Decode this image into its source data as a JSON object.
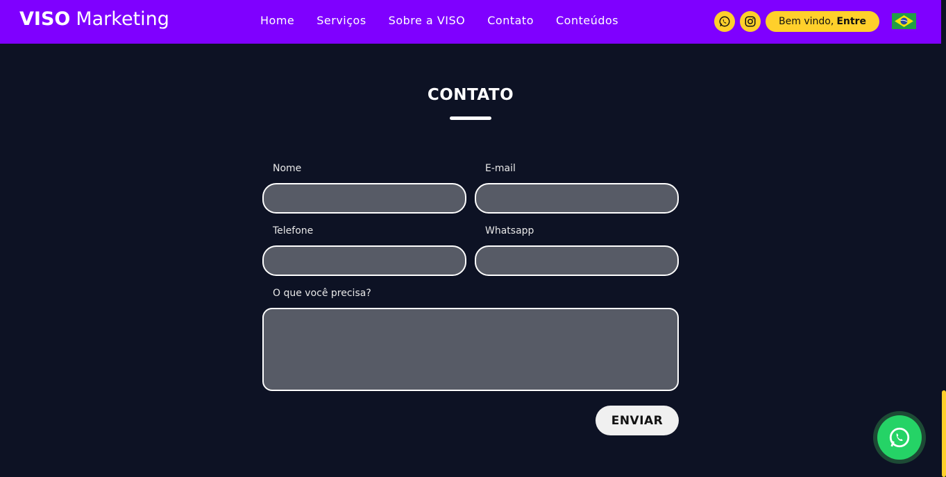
{
  "header": {
    "logo_bold": "VISO",
    "logo_light": "Marketing",
    "nav": [
      "Home",
      "Serviços",
      "Sobre a VISO",
      "Contato",
      "Conteúdos"
    ],
    "login_prefix": "Bem vindo,",
    "login_action": "Entre",
    "social_icons": [
      "whatsapp-icon",
      "instagram-icon"
    ],
    "flag_icon": "brazil-flag-icon",
    "colors": {
      "bar": "#7f00ff",
      "accent": "#ffd02b"
    }
  },
  "contact": {
    "title": "CONTATO",
    "fields": {
      "nome": {
        "label": "Nome",
        "value": ""
      },
      "email": {
        "label": "E-mail",
        "value": ""
      },
      "telefone": {
        "label": "Telefone",
        "value": ""
      },
      "whatsapp": {
        "label": "Whatsapp",
        "value": ""
      },
      "mensagem": {
        "label": "O que você precisa?",
        "value": ""
      }
    },
    "submit_label": "ENVIAR"
  },
  "floating_button_icon": "whatsapp-icon"
}
